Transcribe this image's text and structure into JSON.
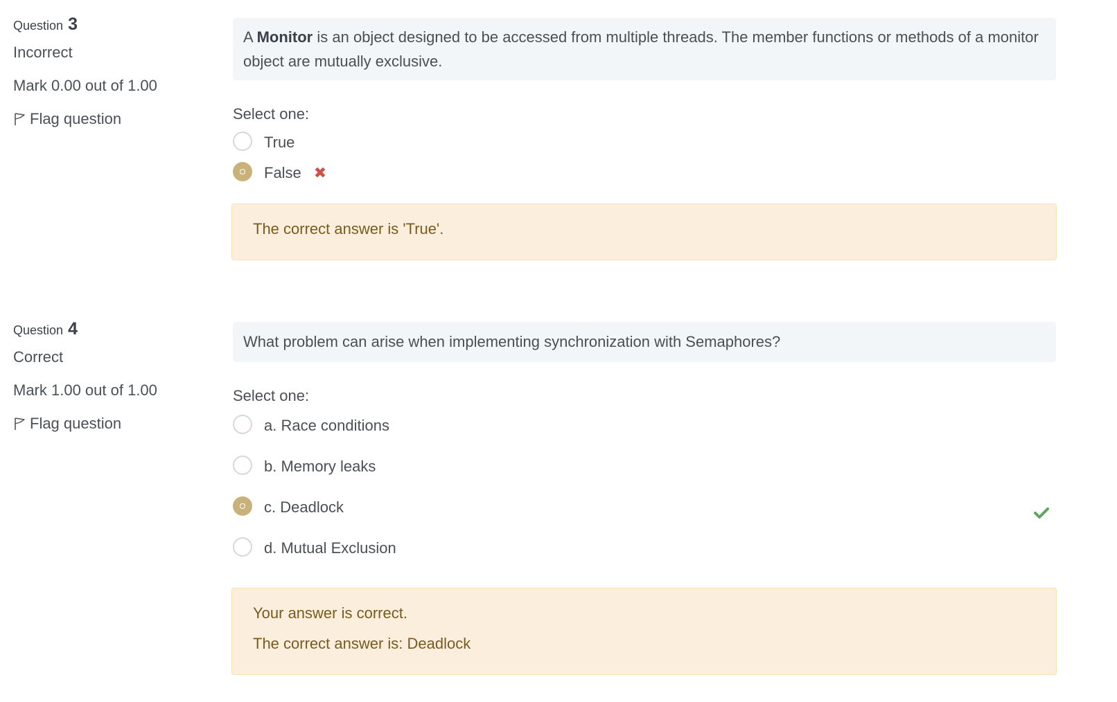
{
  "questions": [
    {
      "label": "Question",
      "number": "3",
      "state": "Incorrect",
      "grade": "Mark 0.00 out of 1.00",
      "flag_label": "Flag question",
      "text_prefix": "A",
      "text_bold": "Monitor",
      "text_suffix": "is an object designed to be accessed from multiple threads. The member functions or methods of a monitor object are mutually exclusive.",
      "prompt": "Select one:",
      "answers": [
        {
          "label": "True",
          "selected": false
        },
        {
          "label": "False",
          "selected": true,
          "mark": "incorrect"
        }
      ],
      "incorrect_icon": "✖",
      "feedback": [
        "The correct answer is 'True'."
      ]
    },
    {
      "label": "Question",
      "number": "4",
      "state": "Correct",
      "grade": "Mark 1.00 out of 1.00",
      "flag_label": "Flag question",
      "text": "What problem can arise when implementing synchronization with Semaphores?",
      "prompt": "Select one:",
      "answers": [
        {
          "label": "a. Race conditions",
          "selected": false
        },
        {
          "label": "b. Memory leaks",
          "selected": false
        },
        {
          "label": "c. Deadlock",
          "selected": true,
          "mark": "correct"
        },
        {
          "label": "d. Mutual Exclusion",
          "selected": false
        }
      ],
      "feedback": [
        "Your answer is correct.",
        "The correct answer is: Deadlock"
      ]
    }
  ],
  "colors": {
    "selected_radio": "#c9b27a",
    "incorrect": "#d0504a",
    "correct": "#5aa85a",
    "feedback_bg": "#fbeedd",
    "qtext_bg": "#f2f6f9"
  },
  "icons": {
    "flag": "flag-icon",
    "incorrect": "x-mark-icon",
    "correct": "check-icon"
  }
}
